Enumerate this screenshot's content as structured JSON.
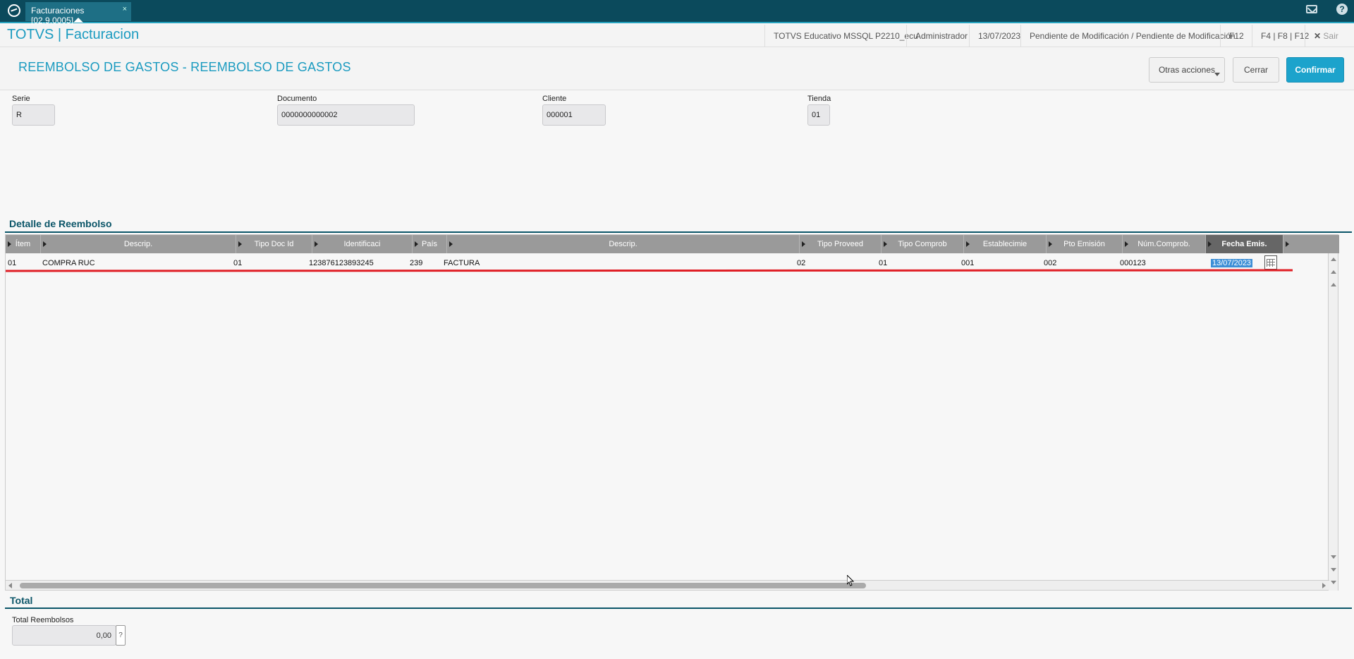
{
  "tab": {
    "label": "Facturaciones [02.9.0005]",
    "close": "×"
  },
  "header": {
    "app_title": "TOTVS | Facturacion",
    "environment": "TOTVS Educativo MSSQL P2210_ecu",
    "user": "Administrador",
    "date": "13/07/2023",
    "status": "Pendiente de Modificación / Pendiente de Modificación",
    "shortcut1": "F12",
    "shortcut2": "F4 | F8 | F12",
    "exit": "Sair"
  },
  "page": {
    "title": "REEMBOLSO DE GASTOS - REEMBOLSO DE GASTOS",
    "actions": {
      "other": "Otras acciones",
      "close": "Cerrar",
      "confirm": "Confirmar"
    }
  },
  "form": {
    "serie": {
      "label": "Serie",
      "value": "R"
    },
    "documento": {
      "label": "Documento",
      "value": "0000000000002"
    },
    "cliente": {
      "label": "Cliente",
      "value": "000001"
    },
    "tienda": {
      "label": "Tienda",
      "value": "01"
    }
  },
  "detail": {
    "title": "Detalle de Reembolso",
    "columns": [
      "Ítem",
      "Descrip.",
      "Tipo Doc Id",
      "Identificaci",
      "País",
      "Descrip.",
      "Tipo Proveed",
      "Tipo Comprob",
      "Establecimie",
      "Pto Emisión",
      "Núm.Comprob.",
      "Fecha Emis."
    ],
    "rows": [
      {
        "item": "01",
        "descrip": "COMPRA RUC",
        "tipo_doc_id": "01",
        "identificacion": "123876123893245",
        "pais": "239",
        "descrip2": "FACTURA",
        "tipo_proveed": "02",
        "tipo_comprob": "01",
        "establecimiento": "001",
        "pto_emision": "002",
        "num_comprob": "000123",
        "fecha_emis": "13/07/2023"
      }
    ]
  },
  "total": {
    "title": "Total",
    "label": "Total Reembolsos",
    "value": "0,00",
    "help": "?"
  },
  "colors": {
    "brand": "#1b9bc0",
    "topbar": "#0b4a5c",
    "primary": "#1ca3cc",
    "highlight": "#e01f26"
  }
}
